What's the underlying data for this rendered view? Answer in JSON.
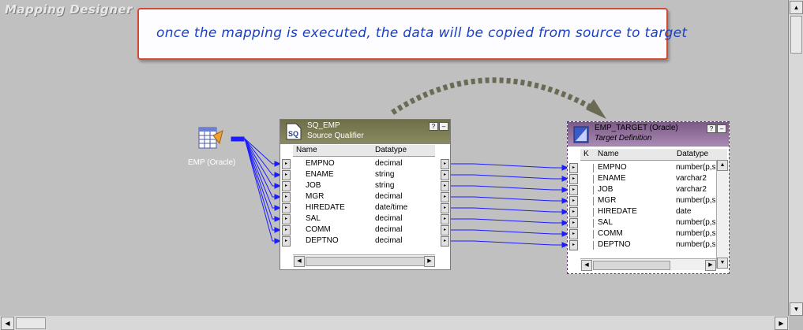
{
  "window": {
    "title": "Mapping Designer"
  },
  "note": {
    "text": "once the mapping is executed, the data will be copied from source to target"
  },
  "source": {
    "label": "EMP (Oracle)"
  },
  "source_qualifier": {
    "name": "SQ_EMP",
    "subtitle": "Source Qualifier",
    "icon_text": "SQ",
    "columns": {
      "name": "Name",
      "datatype": "Datatype"
    },
    "fields": [
      {
        "name": "EMPNO",
        "datatype": "decimal"
      },
      {
        "name": "ENAME",
        "datatype": "string"
      },
      {
        "name": "JOB",
        "datatype": "string"
      },
      {
        "name": "MGR",
        "datatype": "decimal"
      },
      {
        "name": "HIREDATE",
        "datatype": "date/time"
      },
      {
        "name": "SAL",
        "datatype": "decimal"
      },
      {
        "name": "COMM",
        "datatype": "decimal"
      },
      {
        "name": "DEPTNO",
        "datatype": "decimal"
      }
    ]
  },
  "target": {
    "name": "EMP_TARGET (Oracle)",
    "subtitle": "Target Definition",
    "columns": {
      "key": "K",
      "name": "Name",
      "datatype": "Datatype"
    },
    "fields": [
      {
        "name": "EMPNO",
        "datatype": "number(p,s)"
      },
      {
        "name": "ENAME",
        "datatype": "varchar2"
      },
      {
        "name": "JOB",
        "datatype": "varchar2"
      },
      {
        "name": "MGR",
        "datatype": "number(p,s)"
      },
      {
        "name": "HIREDATE",
        "datatype": "date"
      },
      {
        "name": "SAL",
        "datatype": "number(p,s)"
      },
      {
        "name": "COMM",
        "datatype": "number(p,s)"
      },
      {
        "name": "DEPTNO",
        "datatype": "number(p,s)"
      }
    ]
  },
  "colors": {
    "canvas": "#c0c0c0",
    "link": "#1c1cff",
    "note_border": "#d24a35",
    "note_text": "#1a3fc4",
    "arrow": "#6b6b55"
  }
}
